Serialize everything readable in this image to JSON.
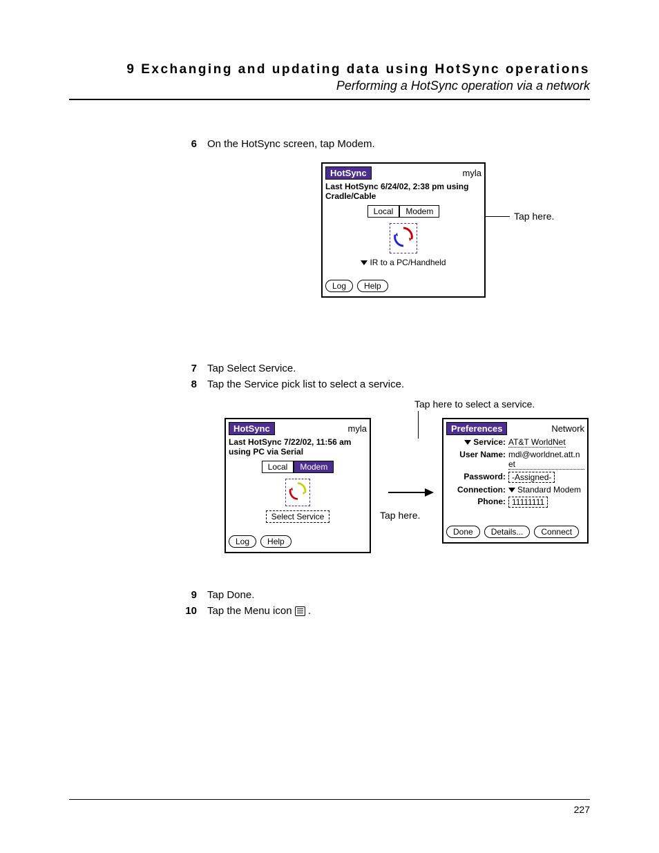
{
  "header": {
    "chapter": "9 Exchanging and updating data using HotSync operations",
    "section": "Performing a HotSync operation via a network"
  },
  "steps": {
    "s6": {
      "n": "6",
      "t": "On the HotSync screen, tap Modem."
    },
    "s7": {
      "n": "7",
      "t": "Tap Select Service."
    },
    "s8": {
      "n": "8",
      "t": "Tap the Service pick list to select a service."
    },
    "s9": {
      "n": "9",
      "t": "Tap Done."
    },
    "s10": {
      "n": "10",
      "t": "Tap the Menu icon "
    }
  },
  "ann": {
    "tapHere": "Tap here.",
    "tapService": "Tap here to select a service."
  },
  "fig1": {
    "title": "HotSync",
    "user": "myla",
    "status": "Last HotSync 6/24/02, 2:38 pm using Cradle/Cable",
    "tabLocal": "Local",
    "tabModem": "Modem",
    "pick": "IR to a PC/Handheld",
    "log": "Log",
    "help": "Help"
  },
  "fig2a": {
    "title": "HotSync",
    "user": "myla",
    "status": "Last HotSync 7/22/02, 11:56 am using PC via Serial",
    "tabLocal": "Local",
    "tabModem": "Modem",
    "select": "Select Service",
    "log": "Log",
    "help": "Help"
  },
  "fig2b": {
    "title": "Preferences",
    "cat": "Network",
    "serviceL": "Service:",
    "service": "AT&T WorldNet",
    "userL": "User Name:",
    "user": "mdl@worldnet.att.net",
    "passL": "Password:",
    "pass": "-Assigned-",
    "connL": "Connection:",
    "conn": "Standard Modem",
    "phoneL": "Phone:",
    "phone": "11111111",
    "done": "Done",
    "details": "Details...",
    "connect": "Connect"
  },
  "pageNum": "227"
}
